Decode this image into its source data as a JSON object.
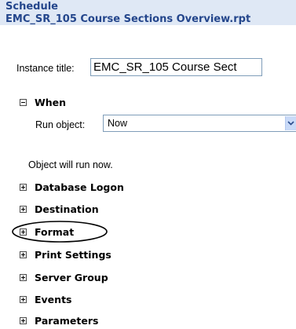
{
  "header": {
    "title": "Schedule",
    "report_name": "EMC_SR_105 Course Sections Overview.rpt"
  },
  "instance": {
    "label": "Instance title:",
    "value": "EMC_SR_105 Course Sect"
  },
  "when": {
    "label": "When",
    "state": "expanded",
    "run_object_label": "Run object:",
    "run_object_value": "Now",
    "note": "Object will run now."
  },
  "sections": [
    {
      "label": "Database Logon",
      "state": "collapsed"
    },
    {
      "label": "Destination",
      "state": "collapsed"
    },
    {
      "label": "Format",
      "state": "collapsed",
      "highlighted": true
    },
    {
      "label": "Print Settings",
      "state": "collapsed"
    },
    {
      "label": "Server Group",
      "state": "collapsed"
    },
    {
      "label": "Events",
      "state": "collapsed"
    },
    {
      "label": "Parameters",
      "state": "collapsed"
    }
  ],
  "icons": {
    "expand": "plus-box-icon",
    "collapse": "minus-box-icon",
    "dropdown": "chevron-down-icon"
  },
  "colors": {
    "header_background": "#dfe8f5",
    "header_text": "#24468c",
    "annotation": "#000000",
    "field_border": "#7f9db9"
  }
}
